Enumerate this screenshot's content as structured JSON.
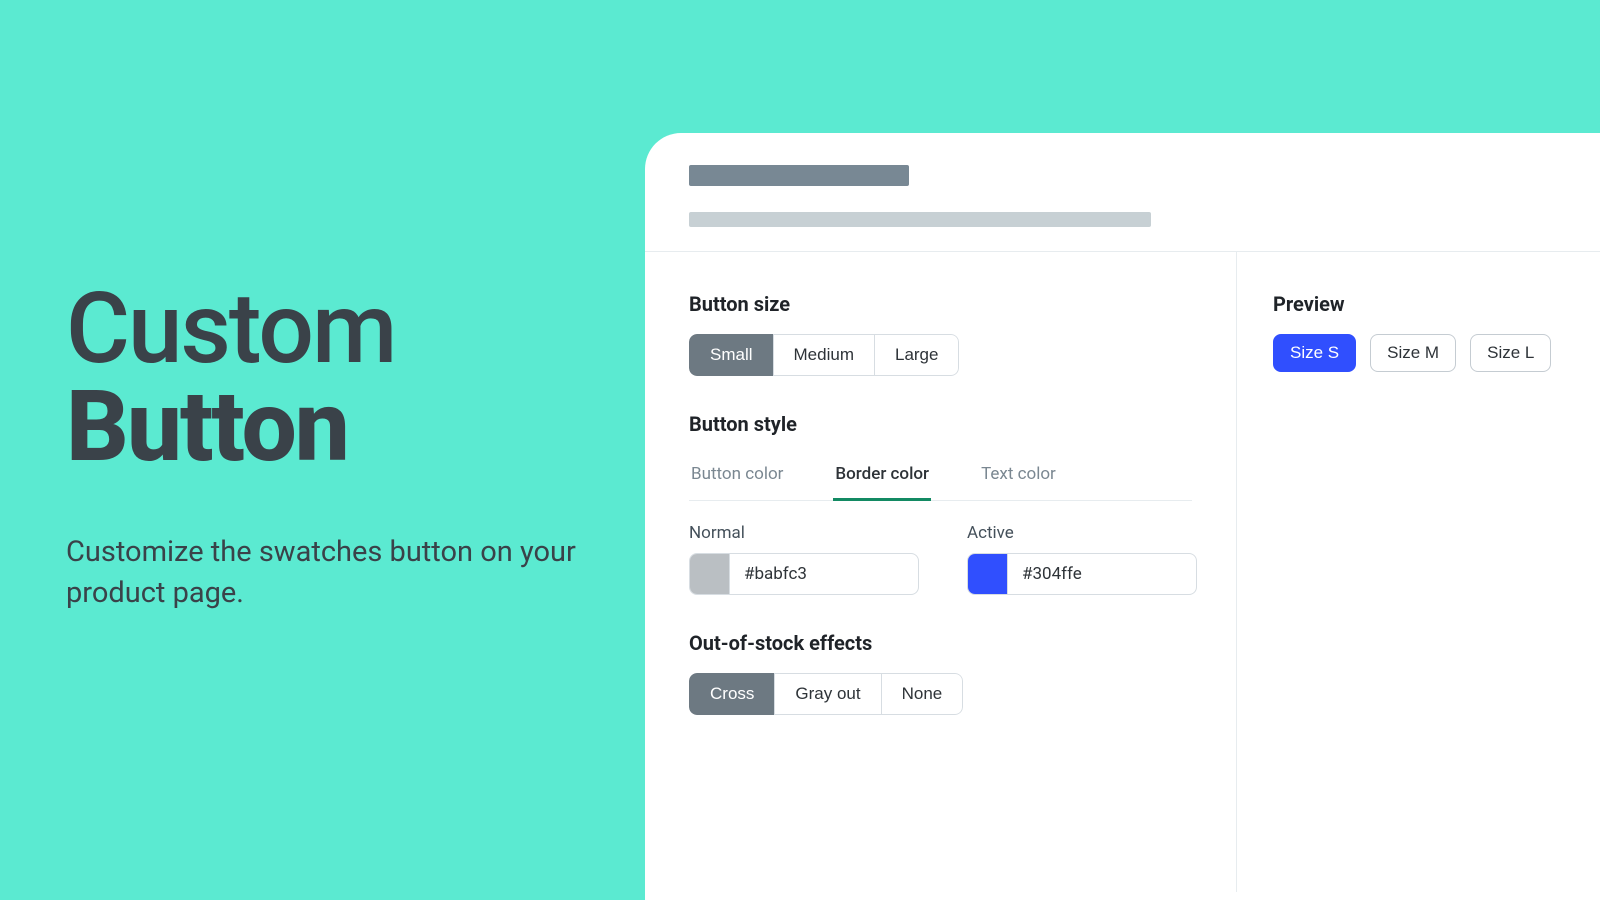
{
  "hero": {
    "title_line1": "Custom",
    "title_line2": "Button",
    "subtitle": "Customize the swatches button on your product page."
  },
  "settings": {
    "button_size": {
      "title": "Button size",
      "options": [
        "Small",
        "Medium",
        "Large"
      ],
      "active_index": 0
    },
    "button_style": {
      "title": "Button style",
      "tabs": [
        "Button color",
        "Border color",
        "Text color"
      ],
      "active_tab_index": 1,
      "normal": {
        "label": "Normal",
        "value": "#babfc3",
        "swatch": "#babfc3"
      },
      "active": {
        "label": "Active",
        "value": "#304ffe",
        "swatch": "#304ffe"
      }
    },
    "oos": {
      "title": "Out-of-stock effects",
      "options": [
        "Cross",
        "Gray out",
        "None"
      ],
      "active_index": 0
    }
  },
  "preview": {
    "title": "Preview",
    "sizes": [
      "Size S",
      "Size M",
      "Size L"
    ],
    "active_index": 0
  },
  "colors": {
    "accent": "#304ffe",
    "teal_bg": "#5bead1",
    "seg_active": "#6d7982",
    "tab_underline": "#138a63"
  }
}
